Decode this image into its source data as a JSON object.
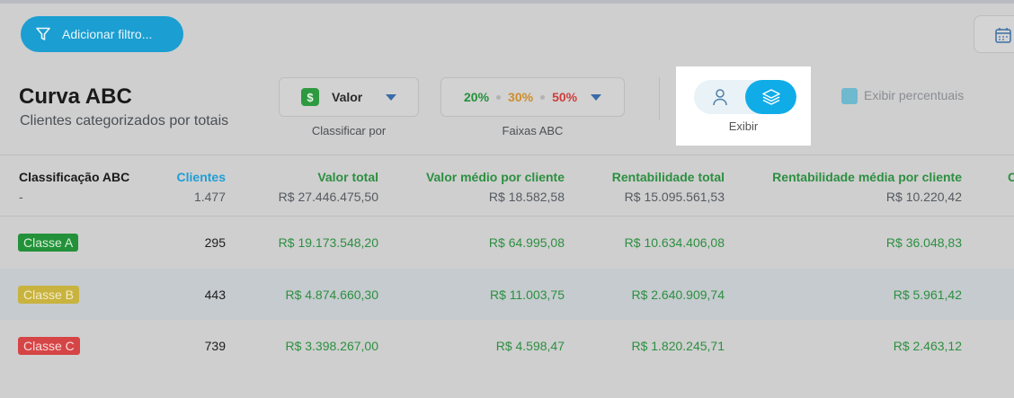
{
  "toolbar": {
    "filter_label": "Adicionar filtro..."
  },
  "header": {
    "title": "Curva ABC",
    "subtitle": "Clientes categorizados por totais"
  },
  "sort": {
    "value": "Valor",
    "caption": "Classificar por",
    "icon": "$"
  },
  "abc": {
    "a": "20%",
    "b": "30%",
    "c": "50%",
    "caption": "Faixas ABC"
  },
  "display": {
    "label": "Exibir",
    "percent_label": "Exibir percentuais"
  },
  "table": {
    "columns": [
      "Classificação ABC",
      "Clientes",
      "Valor total",
      "Valor médio por cliente",
      "Rentabilidade total",
      "Rentabilidade média por cliente",
      "C"
    ],
    "totals": [
      "-",
      "1.477",
      "R$ 27.446.475,50",
      "R$ 18.582,58",
      "R$ 15.095.561,53",
      "R$ 10.220,42"
    ],
    "rows": [
      {
        "badge": "Classe A",
        "clientes": "295",
        "valor_total": "R$ 19.173.548,20",
        "valor_medio": "R$ 64.995,08",
        "rent_total": "R$ 10.634.406,08",
        "rent_media": "R$ 36.048,83"
      },
      {
        "badge": "Classe B",
        "clientes": "443",
        "valor_total": "R$ 4.874.660,30",
        "valor_medio": "R$ 11.003,75",
        "rent_total": "R$ 2.640.909,74",
        "rent_media": "R$ 5.961,42"
      },
      {
        "badge": "Classe C",
        "clientes": "739",
        "valor_total": "R$ 3.398.267,00",
        "valor_medio": "R$ 4.598,47",
        "rent_total": "R$ 1.820.245,71",
        "rent_media": "R$ 2.463,12"
      }
    ]
  },
  "colors": {
    "class_a": "#23913a",
    "class_b": "#c9b33f",
    "class_c": "#d64545",
    "accent": "#10ace8",
    "money": "#2c8f40"
  }
}
